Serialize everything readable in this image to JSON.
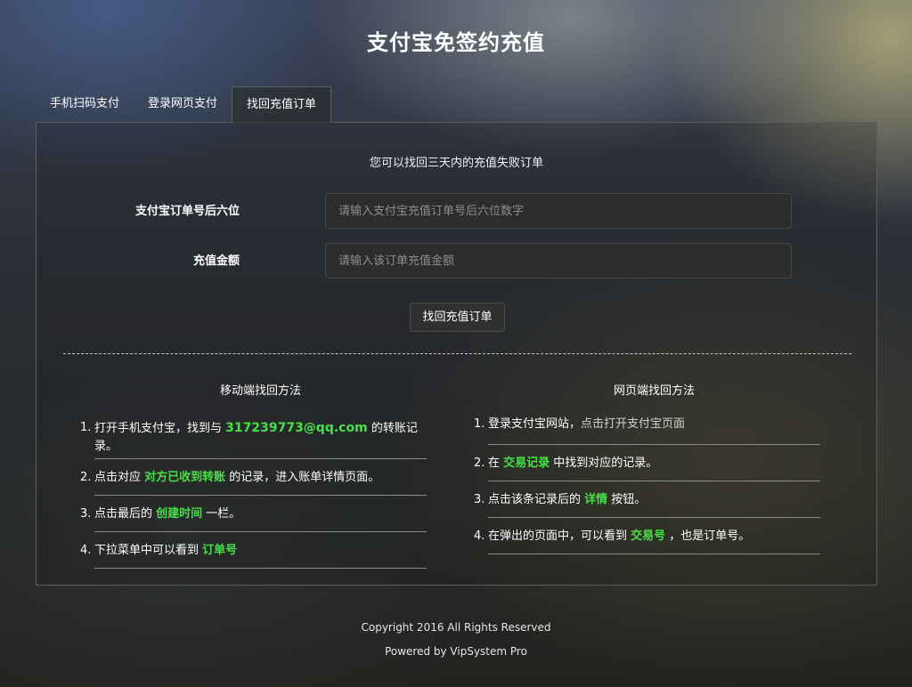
{
  "page": {
    "title": "支付宝免签约充值"
  },
  "tabs": [
    {
      "label": "手机扫码支付",
      "active": false
    },
    {
      "label": "登录网页支付",
      "active": false
    },
    {
      "label": "找回充值订单",
      "active": true
    }
  ],
  "form": {
    "subtitle": "您可以找回三天内的充值失败订单",
    "order_label": "支付宝订单号后六位",
    "order_placeholder": "请输入支付宝充值订单号后六位数字",
    "order_value": "",
    "amount_label": "充值金额",
    "amount_placeholder": "请输入该订单充值金额",
    "amount_value": "",
    "submit_label": "找回充值订单"
  },
  "mobile_method": {
    "title": "移动端找回方法",
    "steps": [
      {
        "num": "1.",
        "pre": "打开手机支付宝，找到与 ",
        "hl": "317239773@qq.com",
        "post": " 的转账记录。"
      },
      {
        "num": "2.",
        "pre": "点击对应 ",
        "hl": "对方已收到转账",
        "post": " 的记录，进入账单详情页面。"
      },
      {
        "num": "3.",
        "pre": "点击最后的 ",
        "hl": "创建时间",
        "post": " 一栏。"
      },
      {
        "num": "4.",
        "pre": "下拉菜单中可以看到 ",
        "hl": "订单号",
        "post": ""
      }
    ]
  },
  "web_method": {
    "title": "网页端找回方法",
    "steps": [
      {
        "num": "1.",
        "pre": "登录支付宝网站，",
        "link": "点击打开支付宝页面",
        "hl": "",
        "post": ""
      },
      {
        "num": "2.",
        "pre": "在 ",
        "hl": "交易记录",
        "post": " 中找到对应的记录。"
      },
      {
        "num": "3.",
        "pre": "点击该条记录后的 ",
        "hl": "详情",
        "post": " 按钮。"
      },
      {
        "num": "4.",
        "pre": "在弹出的页面中，可以看到 ",
        "hl": "交易号",
        "post": " ，也是订单号。"
      }
    ]
  },
  "footer": {
    "copyright": "Copyright 2016 All Rights Reserved",
    "powered": "Powered by VipSystem Pro"
  },
  "colors": {
    "highlight": "#48e048",
    "border": "#5d5f5b"
  }
}
